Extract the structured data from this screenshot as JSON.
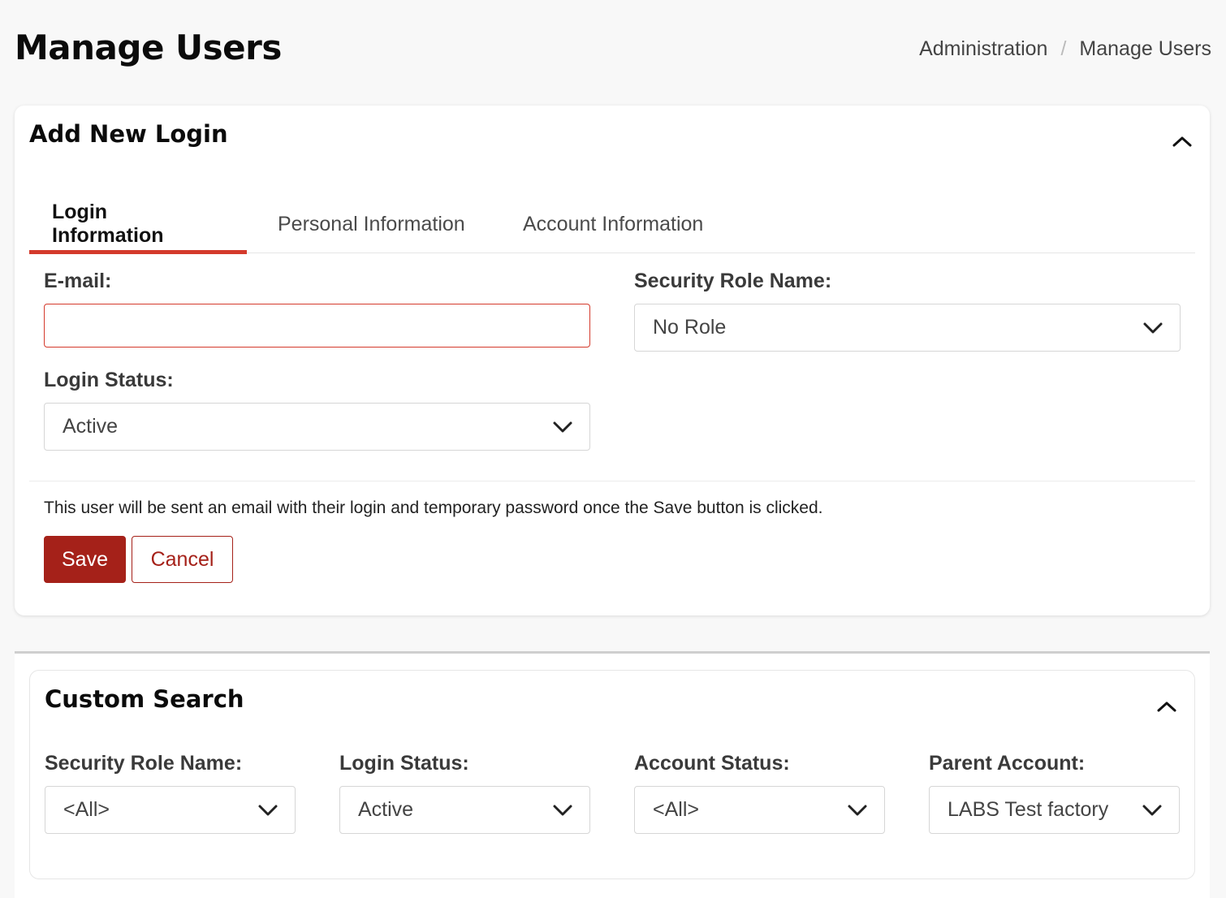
{
  "header": {
    "title": "Manage Users",
    "breadcrumb": [
      {
        "label": "Administration"
      },
      {
        "label": "Manage Users"
      }
    ],
    "breadcrumb_separator": "/"
  },
  "add_login": {
    "title": "Add New Login",
    "collapse_icon": "chevron-up-icon",
    "tabs": [
      {
        "label": "Login Information",
        "active": true
      },
      {
        "label": "Personal Information",
        "active": false
      },
      {
        "label": "Account Information",
        "active": false
      }
    ],
    "email": {
      "label": "E-mail:",
      "value": "",
      "placeholder": ""
    },
    "security_role": {
      "label": "Security Role Name:",
      "value": "No Role"
    },
    "login_status": {
      "label": "Login Status:",
      "value": "Active"
    },
    "notice": "This user will be sent an email with their login and temporary password once the Save button is clicked.",
    "save_label": "Save",
    "cancel_label": "Cancel"
  },
  "custom_search": {
    "title": "Custom Search",
    "collapse_icon": "chevron-up-icon",
    "filters": [
      {
        "label": "Security Role Name:",
        "value": "<All>"
      },
      {
        "label": "Login Status:",
        "value": "Active"
      },
      {
        "label": "Account Status:",
        "value": "<All>"
      },
      {
        "label": "Parent Account:",
        "value": "LABS Test factory"
      }
    ]
  },
  "colors": {
    "accent": "#d43a2c",
    "primary_button": "#a52119",
    "background": "#f8f8f8"
  }
}
